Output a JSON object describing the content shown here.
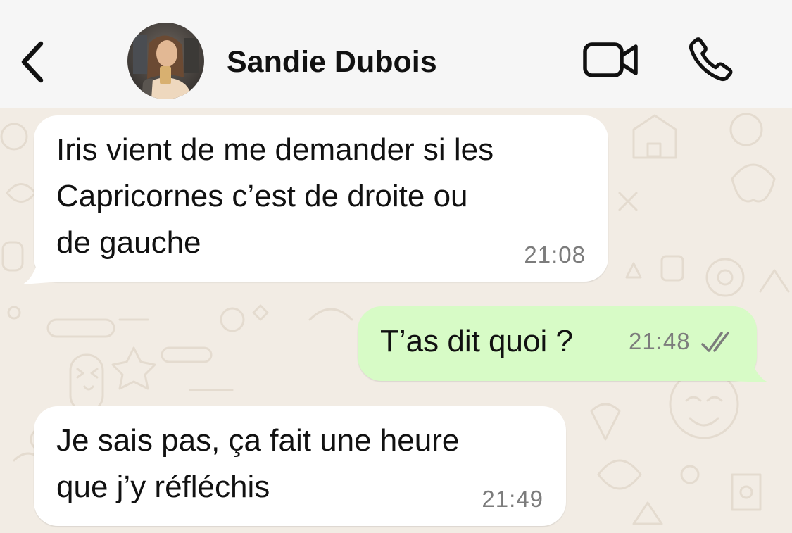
{
  "header": {
    "contact_name": "Sandie Dubois",
    "back_icon": "chevron-left-icon",
    "video_icon": "video-camera-icon",
    "call_icon": "phone-icon"
  },
  "messages": [
    {
      "direction": "incoming",
      "lines": [
        "Iris vient de me demander si les",
        "Capricornes c’est de droite ou",
        "de gauche"
      ],
      "time": "21:08"
    },
    {
      "direction": "outgoing",
      "lines": [
        "T’as dit quoi ?"
      ],
      "time": "21:48",
      "status_icon": "double-check-icon"
    },
    {
      "direction": "incoming",
      "lines": [
        "Je sais pas, ça fait une heure",
        "que j’y réfléchis"
      ],
      "time": "21:49"
    }
  ],
  "colors": {
    "header_bg": "#f6f6f6",
    "chat_bg": "#f2ece4",
    "incoming_bubble": "#ffffff",
    "outgoing_bubble": "#d7fbc6",
    "timestamp": "#7c7c7c"
  }
}
